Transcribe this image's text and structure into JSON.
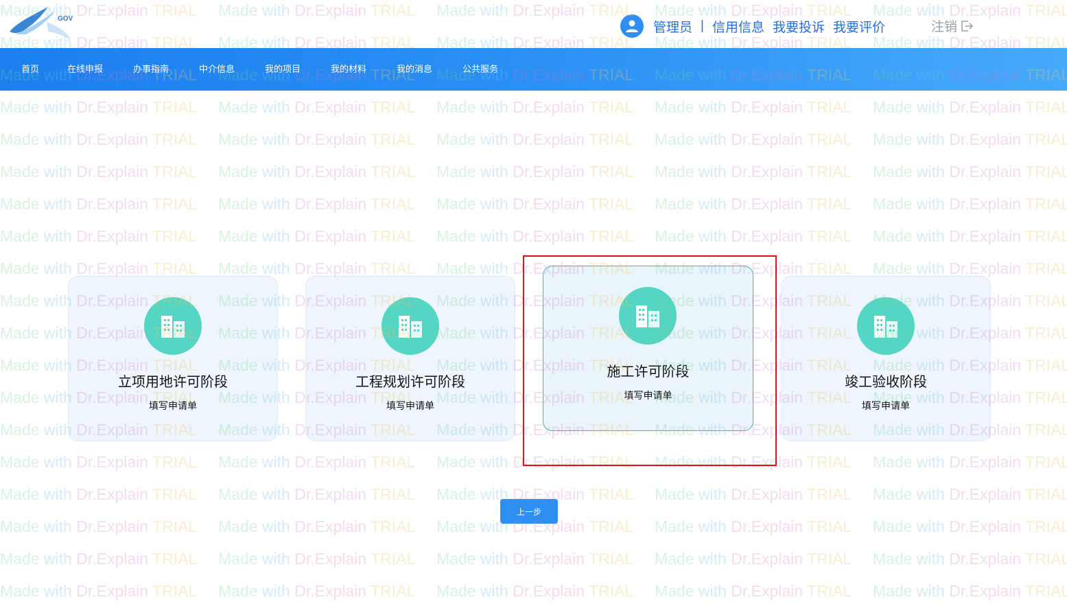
{
  "header": {
    "logo_text": "GOV",
    "user_name": "管理员",
    "separator": "|",
    "links": [
      "信用信息",
      "我要投诉",
      "我要评价"
    ],
    "logout_label": "注销"
  },
  "nav": {
    "items": [
      "首页",
      "在线申报",
      "办事指南",
      "中介信息",
      "我的项目",
      "我的材料",
      "我的消息",
      "公共服务"
    ]
  },
  "stages": [
    {
      "title": "立项用地许可阶段",
      "subtitle": "填写申请单"
    },
    {
      "title": "工程规划许可阶段",
      "subtitle": "填写申请单"
    },
    {
      "title": "施工许可阶段",
      "subtitle": "填写申请单"
    },
    {
      "title": "竣工验收阶段",
      "subtitle": "填写申请单"
    }
  ],
  "selected_stage_index": 2,
  "prev_button_label": "上一步",
  "watermark": {
    "parts": [
      "Made",
      " with ",
      "Dr.Explain",
      " TRIAL"
    ]
  },
  "colors": {
    "primary": "#2f8ff0",
    "icon_bg": "#55d5c4",
    "highlight": "#e0101a",
    "card_bg": "#eef5fd"
  }
}
